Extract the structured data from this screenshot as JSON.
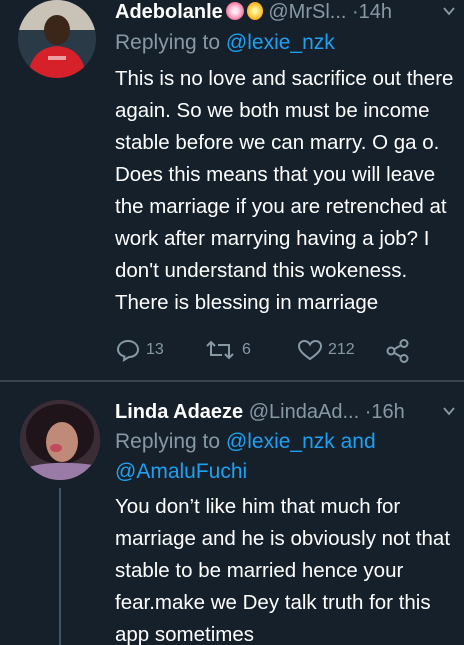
{
  "tweets": [
    {
      "author": {
        "name": "Adebolanle",
        "handle": "@MrSl...",
        "badges": [
          "rose-icon",
          "medal-icon"
        ]
      },
      "time": "14h",
      "reply_prefix": "Replying to",
      "reply_to": "@lexie_nzk",
      "text": "This is no love and sacrifice out there again. So we both must be income stable before we can marry. O ga o. Does this means that you will leave the marriage if you are retrenched at work after marrying having a job? I don't understand this wokeness. There is blessing in marriage",
      "stats": {
        "replies": "13",
        "retweets": "6",
        "likes": "212"
      }
    },
    {
      "author": {
        "name": "Linda Adaeze",
        "handle": "@LindaAd..."
      },
      "time": "16h",
      "reply_prefix": "Replying to",
      "reply_to": "@lexie_nzk and",
      "reply_to_2": "@AmaluFuchi",
      "text": "You don’t like him that much for marriage and he is obviously not that stable to be married hence your fear.make we Dey talk truth for this app sometimes"
    }
  ],
  "separator": "·",
  "colors": {
    "background": "#15202b",
    "secondary_text": "#8899a6",
    "link": "#1da1f2",
    "divider": "#38444d"
  }
}
